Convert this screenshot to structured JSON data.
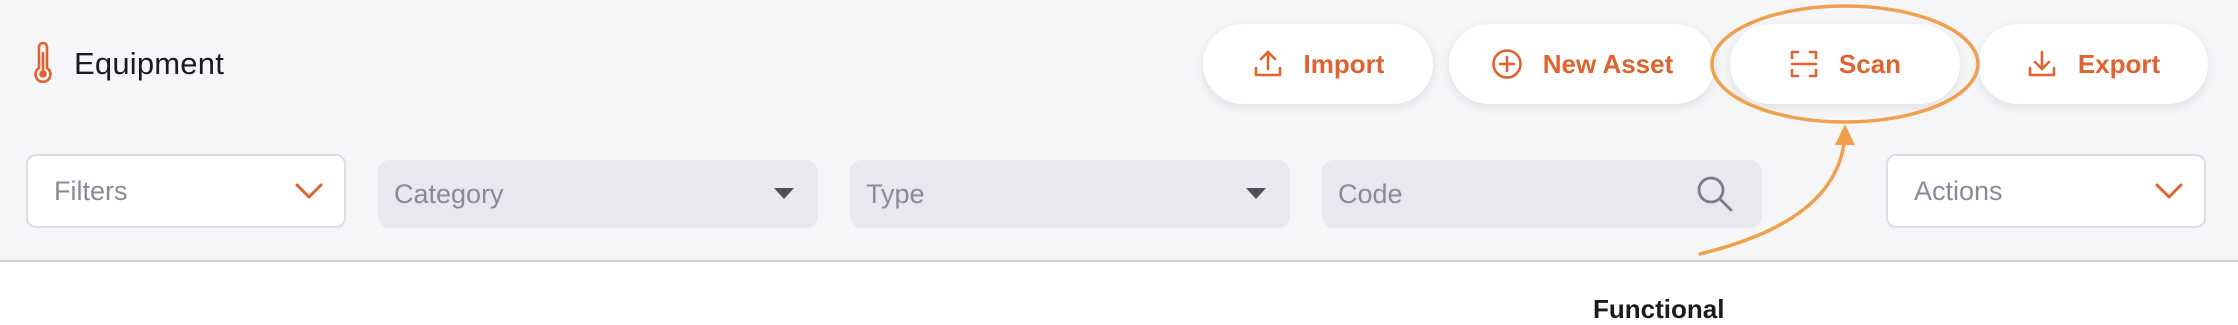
{
  "header": {
    "title": "Equipment",
    "icon": "thermometer-icon"
  },
  "toolbar": {
    "accent_color": "#e0622e",
    "buttons": [
      {
        "label": "Import",
        "icon": "upload-icon"
      },
      {
        "label": "New Asset",
        "icon": "plus-circle-icon"
      },
      {
        "label": "Scan",
        "icon": "scan-icon",
        "highlighted": true
      },
      {
        "label": "Export",
        "icon": "download-icon"
      }
    ]
  },
  "filters": {
    "filters_label": "Filters",
    "category_placeholder": "Category",
    "type_placeholder": "Type",
    "code_placeholder": "Code",
    "actions_label": "Actions"
  },
  "annotation": {
    "color": "#f0a04b",
    "target": "Scan"
  },
  "table": {
    "partial_header": "Functional"
  }
}
